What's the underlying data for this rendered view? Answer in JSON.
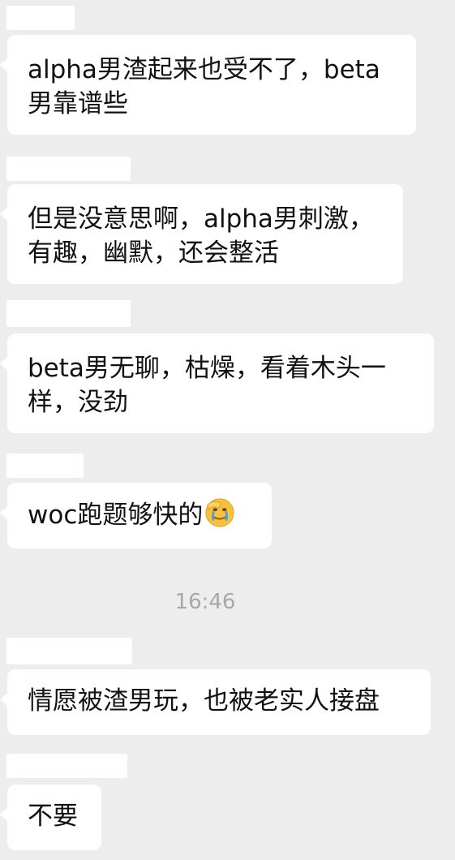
{
  "messages": [
    {
      "text": "alpha男渣起来也受不了，beta\n男靠谱些"
    },
    {
      "text": "但是没意思啊，alpha男刺激，\n有趣，幽默，还会整活"
    },
    {
      "text": "beta男无聊，枯燥，看着木头一\n样，没劲"
    },
    {
      "text": "woc跑题够快的",
      "emoji": "facepalm-crying-emoji"
    },
    {
      "text": "情愿被渣男玩，也被老实人接盘"
    },
    {
      "text": "不要"
    }
  ],
  "timestamp": "16:46",
  "colors": {
    "background": "#ededed",
    "bubble": "#ffffff",
    "text": "#111111",
    "timestamp": "#a8a8a8"
  }
}
